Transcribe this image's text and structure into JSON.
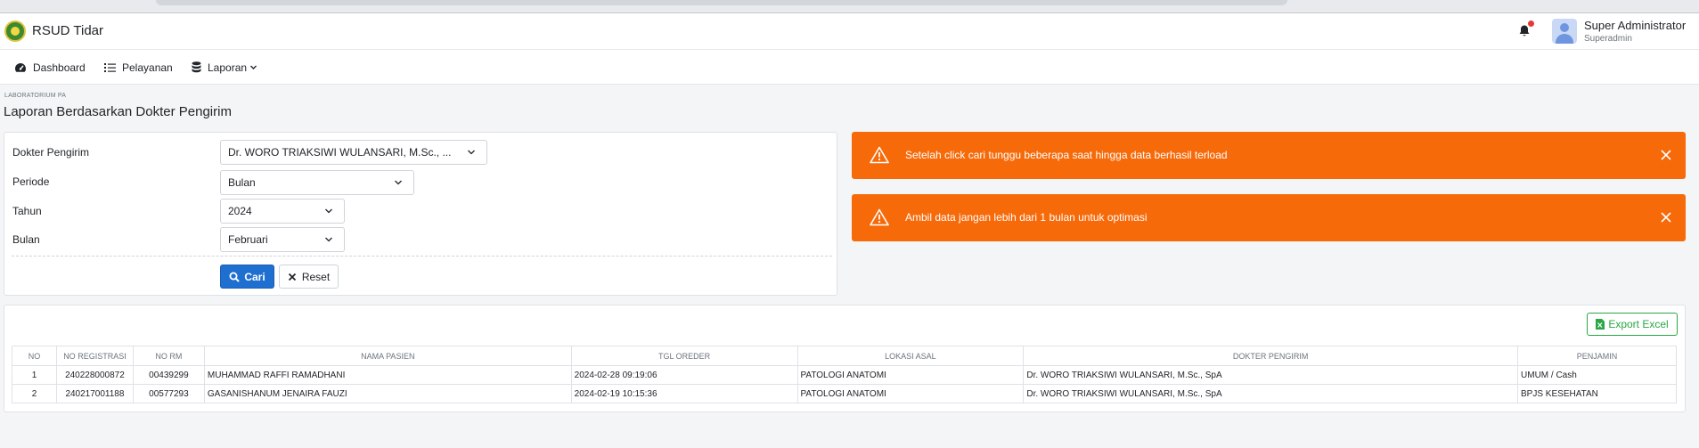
{
  "app": {
    "title": "RSUD Tidar"
  },
  "user": {
    "name": "Super Administrator",
    "role": "Superadmin"
  },
  "nav": [
    {
      "label": "Dashboard",
      "icon": "dashboard-icon"
    },
    {
      "label": "Pelayanan",
      "icon": "list-icon"
    },
    {
      "label": "Laporan",
      "icon": "database-icon"
    }
  ],
  "breadcrumb": "LABORATORIUM PA",
  "page_title": "Laporan Berdasarkan Dokter Pengirim",
  "form": {
    "dokter_label": "Dokter Pengirim",
    "dokter_value": "Dr. WORO TRIAKSIWI WULANSARI, M.Sc., ...",
    "periode_label": "Periode",
    "periode_value": "Bulan",
    "tahun_label": "Tahun",
    "tahun_value": "2024",
    "bulan_label": "Bulan",
    "bulan_value": "Februari",
    "cari_label": "Cari",
    "reset_label": "Reset"
  },
  "alerts": [
    {
      "message": "Setelah click cari tunggu beberapa saat hingga data berhasil terload"
    },
    {
      "message": "Ambil data jangan lebih dari 1 bulan untuk optimasi"
    }
  ],
  "export_label": "Export Excel",
  "table": {
    "headers": [
      "NO",
      "NO REGISTRASI",
      "NO RM",
      "NAMA PASIEN",
      "TGL OREDER",
      "LOKASI ASAL",
      "DOKTER PENGIRIM",
      "PENJAMIN"
    ],
    "rows": [
      [
        "1",
        "240228000872",
        "00439299",
        "MUHAMMAD RAFFI RAMADHANI",
        "2024-02-28 09:19:06",
        "PATOLOGI ANATOMI",
        "Dr. WORO TRIAKSIWI WULANSARI, M.Sc., SpA",
        "UMUM / Cash"
      ],
      [
        "2",
        "240217001188",
        "00577293",
        "GASANISHANUM JENAIRA FAUZI",
        "2024-02-19 10:15:36",
        "PATOLOGI ANATOMI",
        "Dr. WORO TRIAKSIWI WULANSARI, M.Sc., SpA",
        "BPJS KESEHATAN"
      ]
    ]
  },
  "colors": {
    "accent": "#1f6fd1",
    "alert": "#f66a0a",
    "export": "#28a745"
  }
}
